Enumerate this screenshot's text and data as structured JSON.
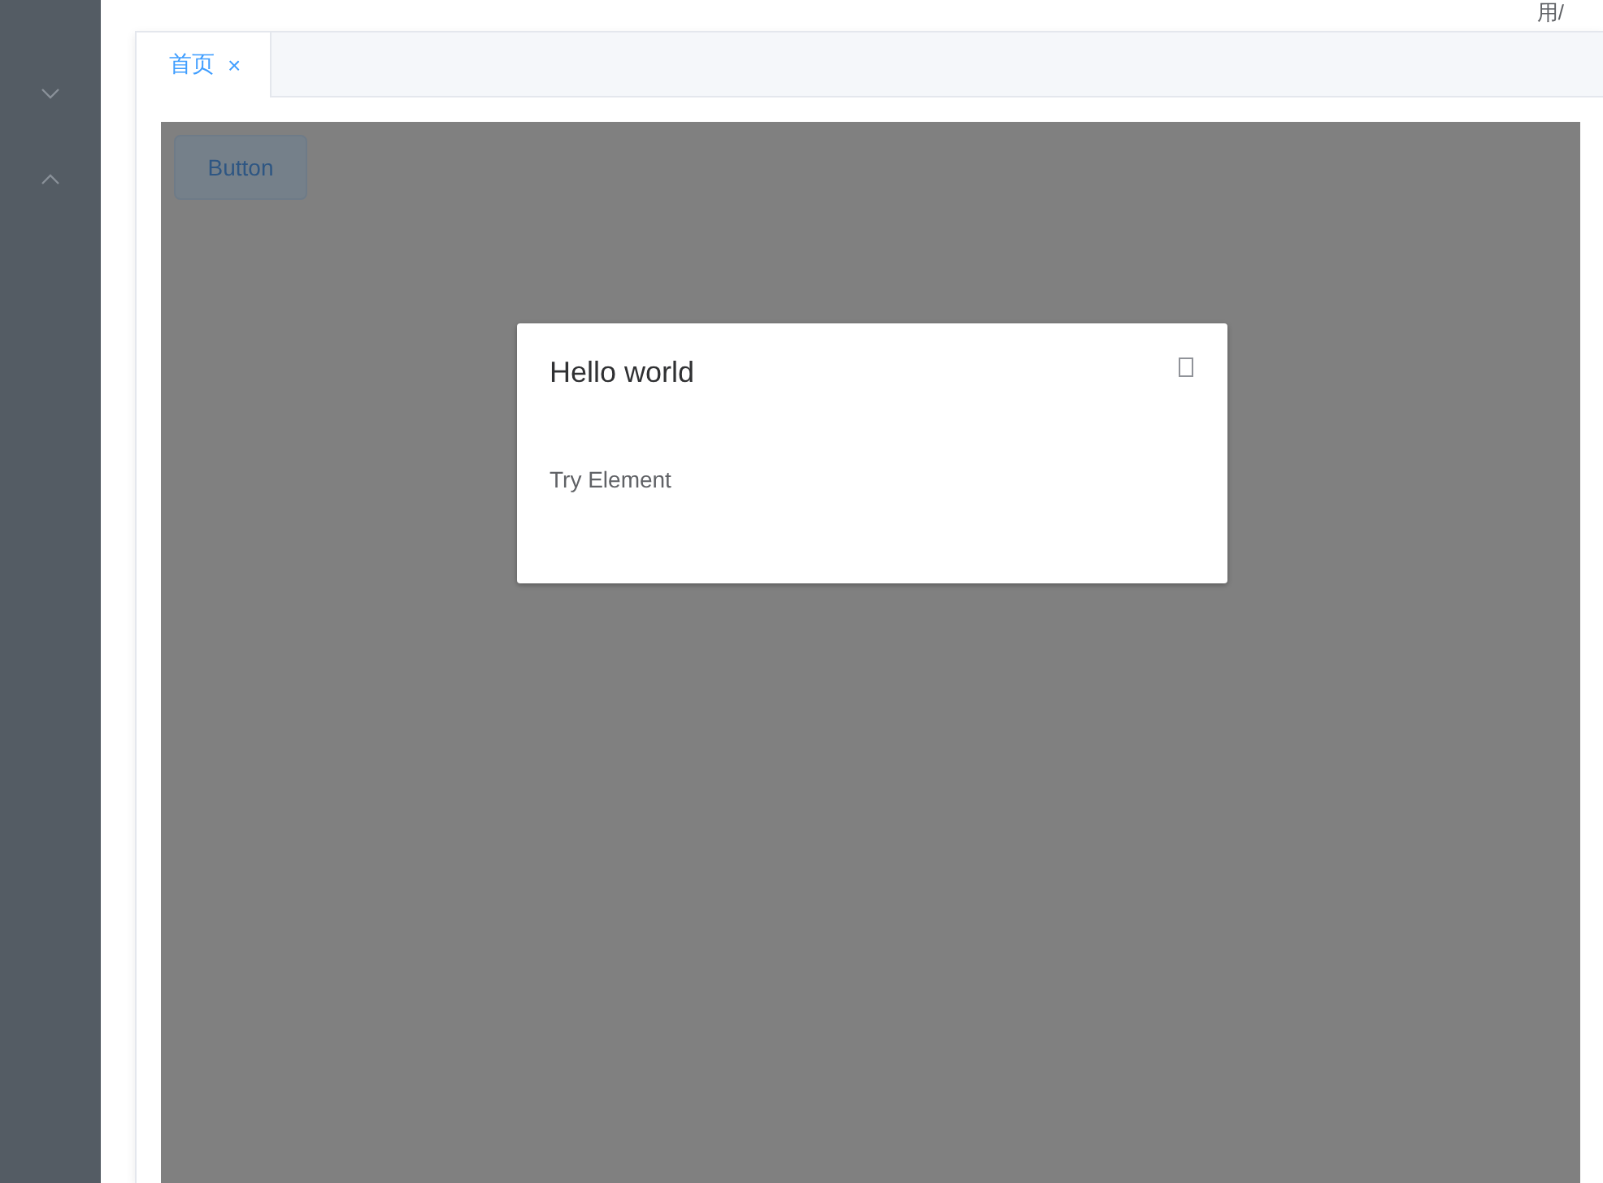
{
  "header": {
    "breadcrumb": "用/"
  },
  "sidebar": {
    "submenus": [
      {
        "expanded": false
      },
      {
        "expanded": true
      }
    ]
  },
  "tabs": [
    {
      "label": "首页",
      "close": "×",
      "selected": true
    }
  ],
  "content": {
    "button": "Button"
  },
  "dialog": {
    "title": "Hello world",
    "body": "Try Element"
  }
}
